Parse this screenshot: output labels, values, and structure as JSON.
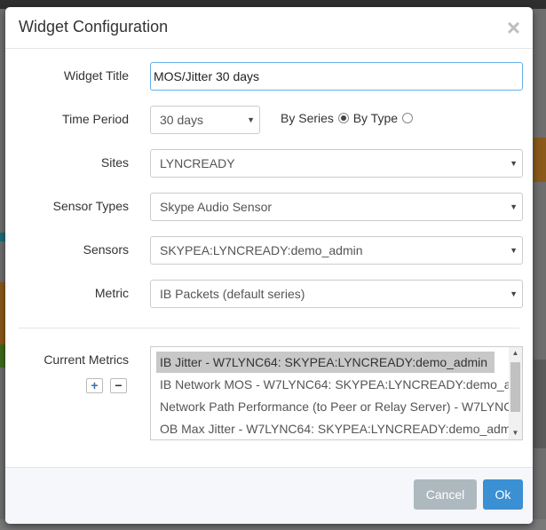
{
  "modal": {
    "title": "Widget Configuration",
    "close_glyph": "×"
  },
  "form": {
    "widget_title": {
      "label": "Widget Title",
      "value": "MOS/Jitter 30 days"
    },
    "time_period": {
      "label": "Time Period",
      "value": "30 days",
      "by_series_label": "By Series",
      "by_type_label": "By Type",
      "by_series_checked": true,
      "by_type_checked": false
    },
    "sites": {
      "label": "Sites",
      "value": "LYNCREADY"
    },
    "sensor_types": {
      "label": "Sensor Types",
      "value": "Skype Audio Sensor"
    },
    "sensors": {
      "label": "Sensors",
      "value": "SKYPEA:LYNCREADY:demo_admin"
    },
    "metric": {
      "label": "Metric",
      "value": "IB Packets (default series)"
    },
    "current_metrics": {
      "label": "Current Metrics",
      "add_glyph": "+",
      "remove_glyph": "−",
      "items": [
        "IB Jitter - W7LYNC64: SKYPEA:LYNCREADY:demo_admin",
        "IB Network MOS - W7LYNC64: SKYPEA:LYNCREADY:demo_a",
        "Network Path Performance (to Peer or Relay Server) - W7LYNC",
        "OB Max Jitter - W7LYNC64: SKYPEA:LYNCREADY:demo_adm"
      ],
      "selected_index": 0
    }
  },
  "footer": {
    "cancel_label": "Cancel",
    "ok_label": "Ok"
  },
  "icons": {
    "caret": "▼",
    "scroll_up": "▲",
    "scroll_down": "▼"
  },
  "colors": {
    "ok_button": "#3b8fd3",
    "cancel_button": "#aeb8bf",
    "focus_border": "#66afe9"
  }
}
